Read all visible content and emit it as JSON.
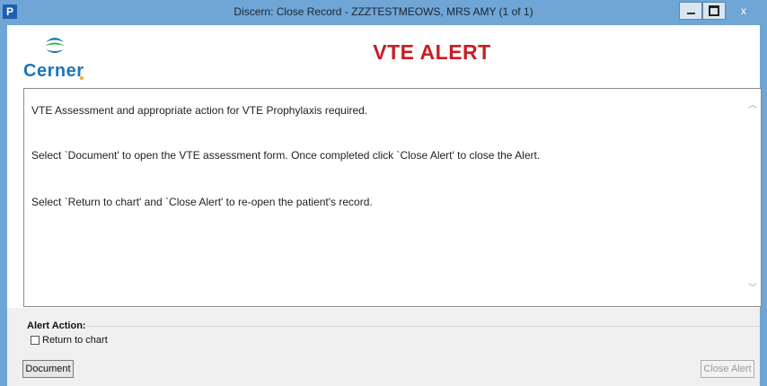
{
  "window": {
    "title": "Discern: Close Record - ZZZTESTMEOWS, MRS AMY (1 of 1)",
    "app_icon_letter": "P",
    "controls": [
      "minimize",
      "maximize",
      "close"
    ],
    "close_glyph": "x"
  },
  "logo": {
    "text": "Cerner",
    "mark_icon": "cerner-logo-mark"
  },
  "header": {
    "title": "VTE ALERT",
    "title_color": "#c81d25"
  },
  "message": {
    "lines": [
      "VTE Assessment and appropriate action for VTE Prophylaxis required.",
      "Select `Document' to open the VTE assessment form. Once completed click `Close Alert' to close the Alert.",
      "Select `Return to chart' and `Close Alert' to re-open the patient's record."
    ]
  },
  "alert_action": {
    "label": "Alert Action:",
    "checkbox_label": "Return to chart",
    "checked": false
  },
  "buttons": {
    "document": "Document",
    "close_alert": "Close Alert",
    "close_alert_enabled": false
  },
  "colors": {
    "frame": "#6fa6d6",
    "logo_blue": "#1d75b9",
    "logo_accent": "#f5a623"
  }
}
